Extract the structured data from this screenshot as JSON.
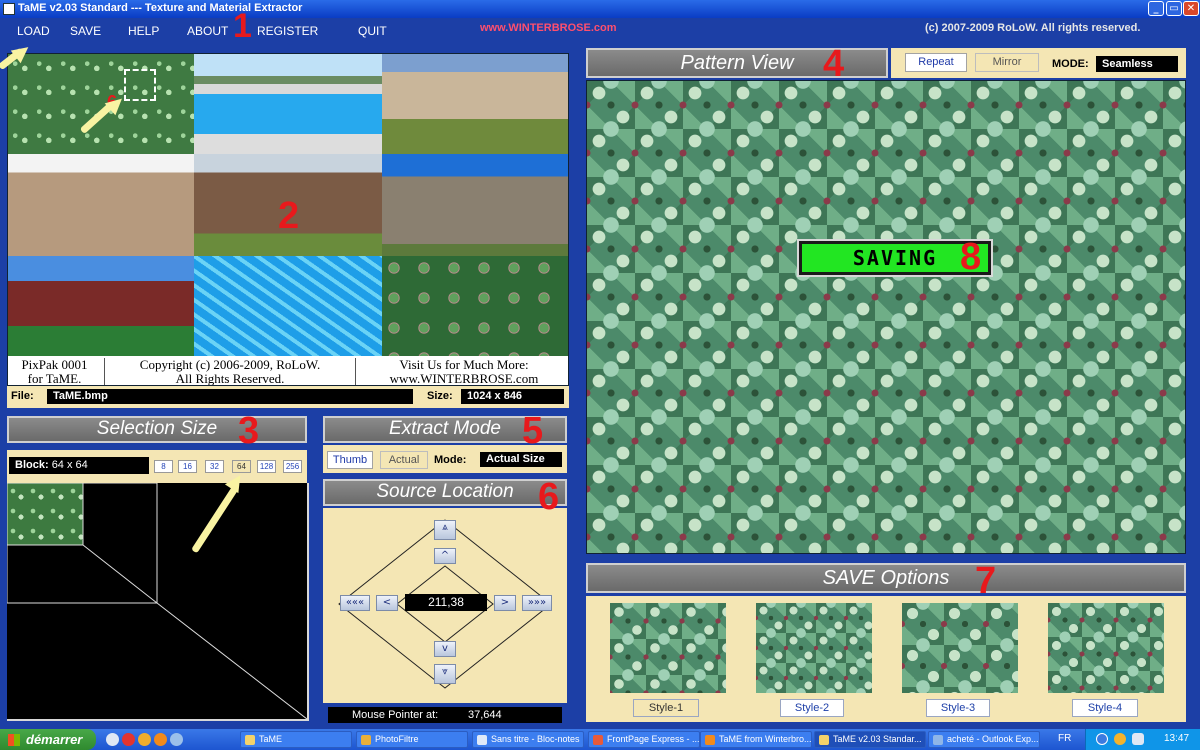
{
  "window": {
    "title": "TaME  v2.03  Standard --- Texture and Material Extractor",
    "controls": [
      "_",
      "▭",
      "✕"
    ]
  },
  "menu": {
    "items": [
      "LOAD",
      "SAVE",
      "HELP",
      "ABOUT",
      "REGISTER",
      "QUIT"
    ],
    "website": "www.WINTERBROSE.com",
    "copyright": "(c) 2007-2009 RoLoW.  All rights reserved."
  },
  "markers": [
    "1",
    "2",
    "3",
    "4",
    "5",
    "6",
    "7",
    "8",
    "6"
  ],
  "pixpak": {
    "captions": [
      "PixPak 0001\nfor TaME.",
      "Copyright (c) 2006-2009, RoLoW.\nAll Rights Reserved.",
      "Visit Us for Much More:\nwww.WINTERBROSE.com"
    ],
    "thumbnails": [
      "ivy-leaves",
      "swimming-pool",
      "sand-dune",
      "sand-pile",
      "firewood-stack",
      "stone-building",
      "brick-building",
      "pool-water",
      "leaf-groundcover"
    ]
  },
  "file_info": {
    "file_label": "File:",
    "file_name": "TaME.bmp",
    "size_label": "Size:",
    "size_value": "1024 x 846"
  },
  "selection_size": {
    "title": "Selection Size",
    "block_label": "Block:",
    "block_value": "64 x 64",
    "sizes": [
      "8",
      "16",
      "32",
      "64",
      "128",
      "256"
    ],
    "selected": "64"
  },
  "extract_mode": {
    "title": "Extract Mode",
    "options": [
      "Thumb",
      "Actual"
    ],
    "mode_label": "Mode:",
    "mode_value": "Actual Size"
  },
  "source_location": {
    "title": "Source Location",
    "coords": "211,38",
    "buttons": {
      "top": "⩓",
      "up": "^",
      "down": "v",
      "bottom": "⩔",
      "far_left": "«««",
      "left": "<",
      "right": ">",
      "far_right": "»»»"
    }
  },
  "mouse_pointer": {
    "label": "Mouse Pointer at:",
    "value": "37,644"
  },
  "pattern_view": {
    "title": "Pattern View",
    "repeat_label": "Repeat",
    "mirror_label": "Mirror",
    "mode_label": "MODE:",
    "mode_value": "Seamless",
    "status": "SAVING"
  },
  "save_options": {
    "title": "SAVE Options",
    "styles": [
      "Style-1",
      "Style-2",
      "Style-3",
      "Style-4"
    ]
  },
  "taskbar": {
    "start": "démarrer",
    "tasks": [
      "TaME",
      "PhotoFiltre",
      "Sans titre - Bloc-notes",
      "FrontPage Express - ...",
      "TaME from Winterbro...",
      "TaME  v2.03  Standar...",
      "acheté - Outlook Exp..."
    ],
    "lang": "FR",
    "time": "13:47"
  },
  "colors": {
    "background": "#1c3fa6",
    "panel": "#f4e6b4",
    "saving": "#22e622",
    "marker": "#e8191c",
    "arrow": "#f9f3a2"
  }
}
